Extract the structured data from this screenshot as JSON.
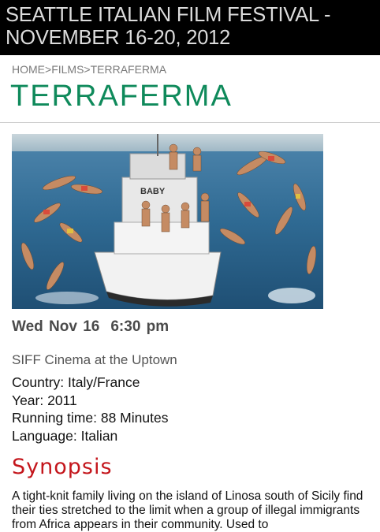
{
  "header": {
    "title": "SEATTLE ITALIAN FILM FESTIVAL - NOVEMBER 16-20, 2012"
  },
  "breadcrumb": {
    "home": "HOME",
    "separator1": ">",
    "films": "FILMS",
    "separator2": ">",
    "current": "TERRAFERMA"
  },
  "film": {
    "title": "TERRAFERMA",
    "image_alt": "Terraferma film still: people jumping from a boat into the sea",
    "boat_name": "BABY",
    "showtime_day": "Wed Nov 16",
    "showtime_time": "6:30 pm",
    "venue": "SIFF Cinema at the Uptown",
    "country": "Country: Italy/France",
    "year": "Year: 2011",
    "running_time": "Running time: 88 Minutes",
    "language": "Language: Italian"
  },
  "synopsis": {
    "heading": "Synopsis",
    "text": "A tight-knit family living on the island of Linosa south of Sicily find their ties stretched to the limit when a group of illegal immigrants from Africa appears in their community. Used to"
  },
  "colors": {
    "banner_bg": "#000000",
    "banner_text": "#dcdcdc",
    "title_green": "#0f8a5b",
    "synopsis_red": "#c4161c"
  }
}
